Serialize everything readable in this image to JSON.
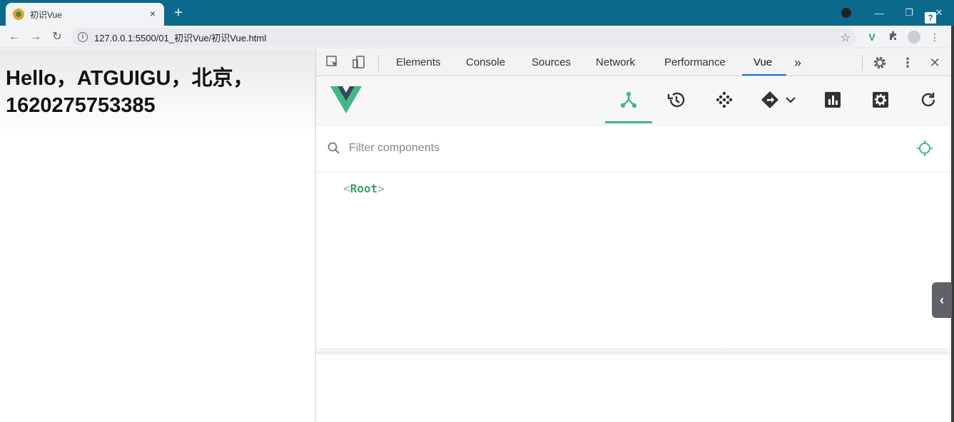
{
  "browser": {
    "tab_title": "初识Vue",
    "tab_close": "×",
    "new_tab": "+",
    "window_controls": {
      "minimize": "—",
      "restore": "❐",
      "close": "✕"
    },
    "help_badge": "?"
  },
  "toolbar": {
    "back": "←",
    "forward": "→",
    "reload": "↻",
    "info": "i",
    "url": "127.0.0.1:5500/01_初识Vue/初识Vue.html",
    "star": "☆",
    "menu": "⋮"
  },
  "page": {
    "heading": "Hello，ATGUIGU，北京，1620275753385"
  },
  "devtools": {
    "tabs": [
      "Elements",
      "Console",
      "Sources",
      "Network",
      "Performance",
      "Vue"
    ],
    "more_tabs": "»",
    "active_tab": "Vue",
    "close": "✕",
    "vue": {
      "filter_placeholder": "Filter components",
      "tree": {
        "open_bracket": "<",
        "name": "Root",
        "close_bracket": ">"
      },
      "accent": "#42b883"
    }
  },
  "side_handle": "‹",
  "colors": {
    "tabstrip": "#0b6a8b",
    "vue_green": "#42b883",
    "vue_dark": "#35495e"
  }
}
